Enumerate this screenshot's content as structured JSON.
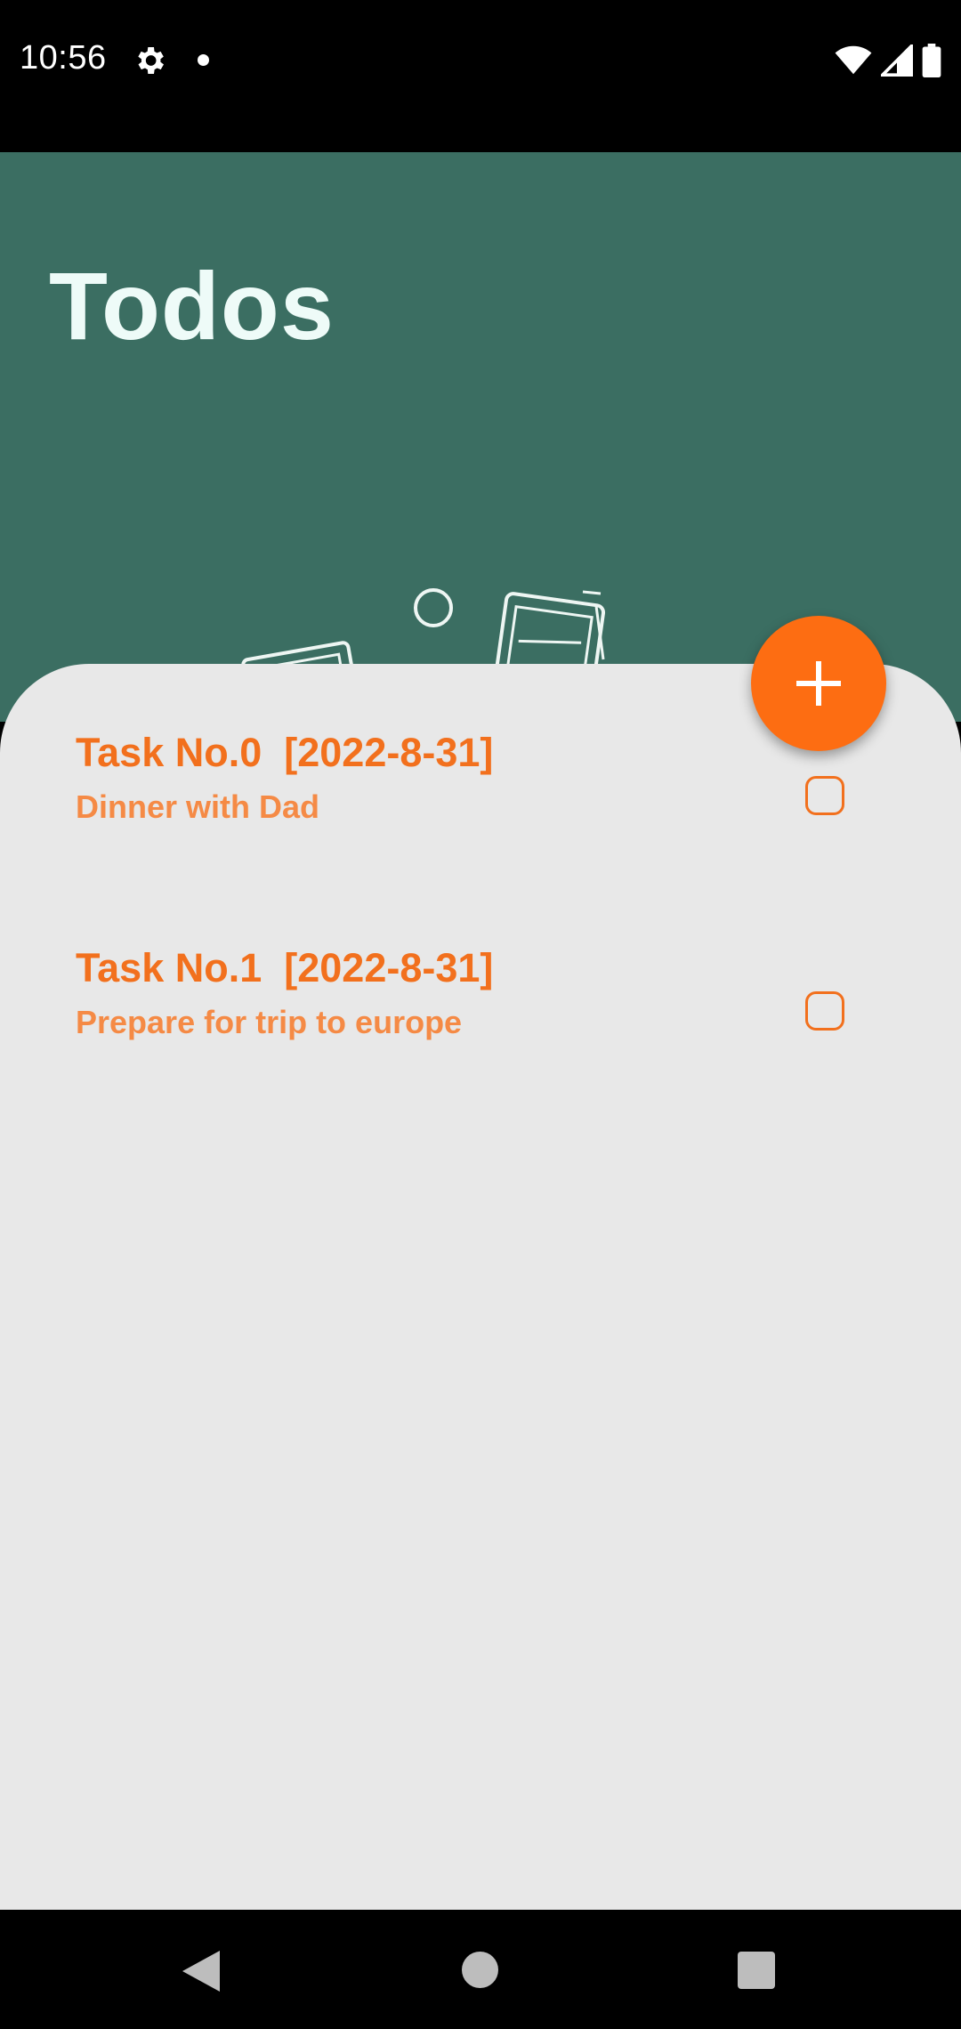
{
  "status_bar": {
    "time": "10:56",
    "icons": [
      "gear-icon",
      "notification-dot-icon",
      "wifi-icon",
      "signal-icon",
      "battery-icon"
    ]
  },
  "header": {
    "title": "Todos",
    "background_color": "#3b6e62"
  },
  "todos": [
    {
      "title": "Task No.0  [2022-8-31]",
      "description": "Dinner with Dad",
      "checked": false
    },
    {
      "title": "Task No.1  [2022-8-31]",
      "description": "Prepare for trip to europe",
      "checked": false
    }
  ],
  "fab": {
    "icon": "plus-icon",
    "color": "#fd6d12"
  },
  "nav_bar": {
    "icons": [
      "back-icon",
      "home-icon",
      "recents-icon"
    ]
  },
  "colors": {
    "accent": "#f2701d",
    "card_background": "#e8e8e8"
  }
}
